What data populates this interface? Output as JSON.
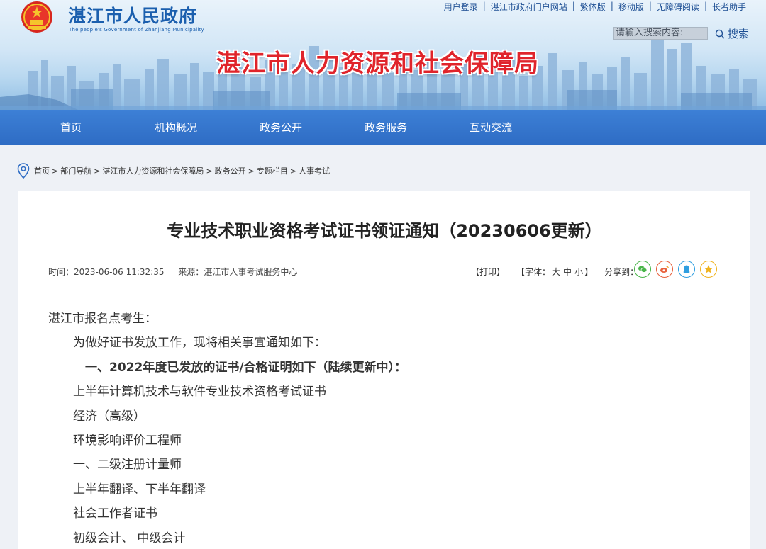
{
  "header": {
    "gov_name": "湛江市人民政府",
    "gov_subtitle": "The people's Government of Zhanjiang Municipality",
    "bureau_name": "湛江市人力资源和社会保障局",
    "top_links": [
      "用户登录",
      "湛江市政府门户网站",
      "繁体版",
      "移动版",
      "无障碍阅读",
      "长者助手"
    ],
    "search_placeholder": "请输入搜索内容:",
    "search_label": "搜索",
    "logo_icon": "national-emblem-icon",
    "colors": {
      "gov_blue": "#1b5fae",
      "bureau_red": "#e0242b",
      "nav_blue": "#2e6cc4"
    }
  },
  "nav": {
    "items": [
      "首页",
      "机构概况",
      "政务公开",
      "政务服务",
      "互动交流"
    ]
  },
  "breadcrumb": {
    "items": [
      "首页",
      "部门导航",
      "湛江市人力资源和社会保障局",
      "政务公开",
      "专题栏目",
      "人事考试"
    ],
    "separator": ">"
  },
  "article": {
    "title": "专业技术职业资格考试证书领证通知（20230606更新）",
    "time_label": "时间：",
    "time": "2023-06-06 11:32:35",
    "source_label": "来源：",
    "source": "湛江市人事考试服务中心",
    "print": "【打印】",
    "font_label": "【字体：",
    "font_sizes": [
      "大",
      "中",
      "小"
    ],
    "font_close": "】",
    "share_label": "分享到：",
    "share_icons": [
      "wechat-icon",
      "weibo-icon",
      "qq-icon",
      "qzone-icon"
    ],
    "greeting": "湛江市报名点考生：",
    "intro": "为做好证书发放工作，现将相关事宜通知如下：",
    "section1": "一、2022年度已发放的证书/合格证明如下（陆续更新中）：",
    "list": [
      "上半年计算机技术与软件专业技术资格考试证书",
      "经济（高级）",
      "环境影响评价工程师",
      "一、二级注册计量师",
      "上半年翻译、下半年翻译",
      "社会工作者证书",
      "初级会计、 中级会计"
    ]
  }
}
